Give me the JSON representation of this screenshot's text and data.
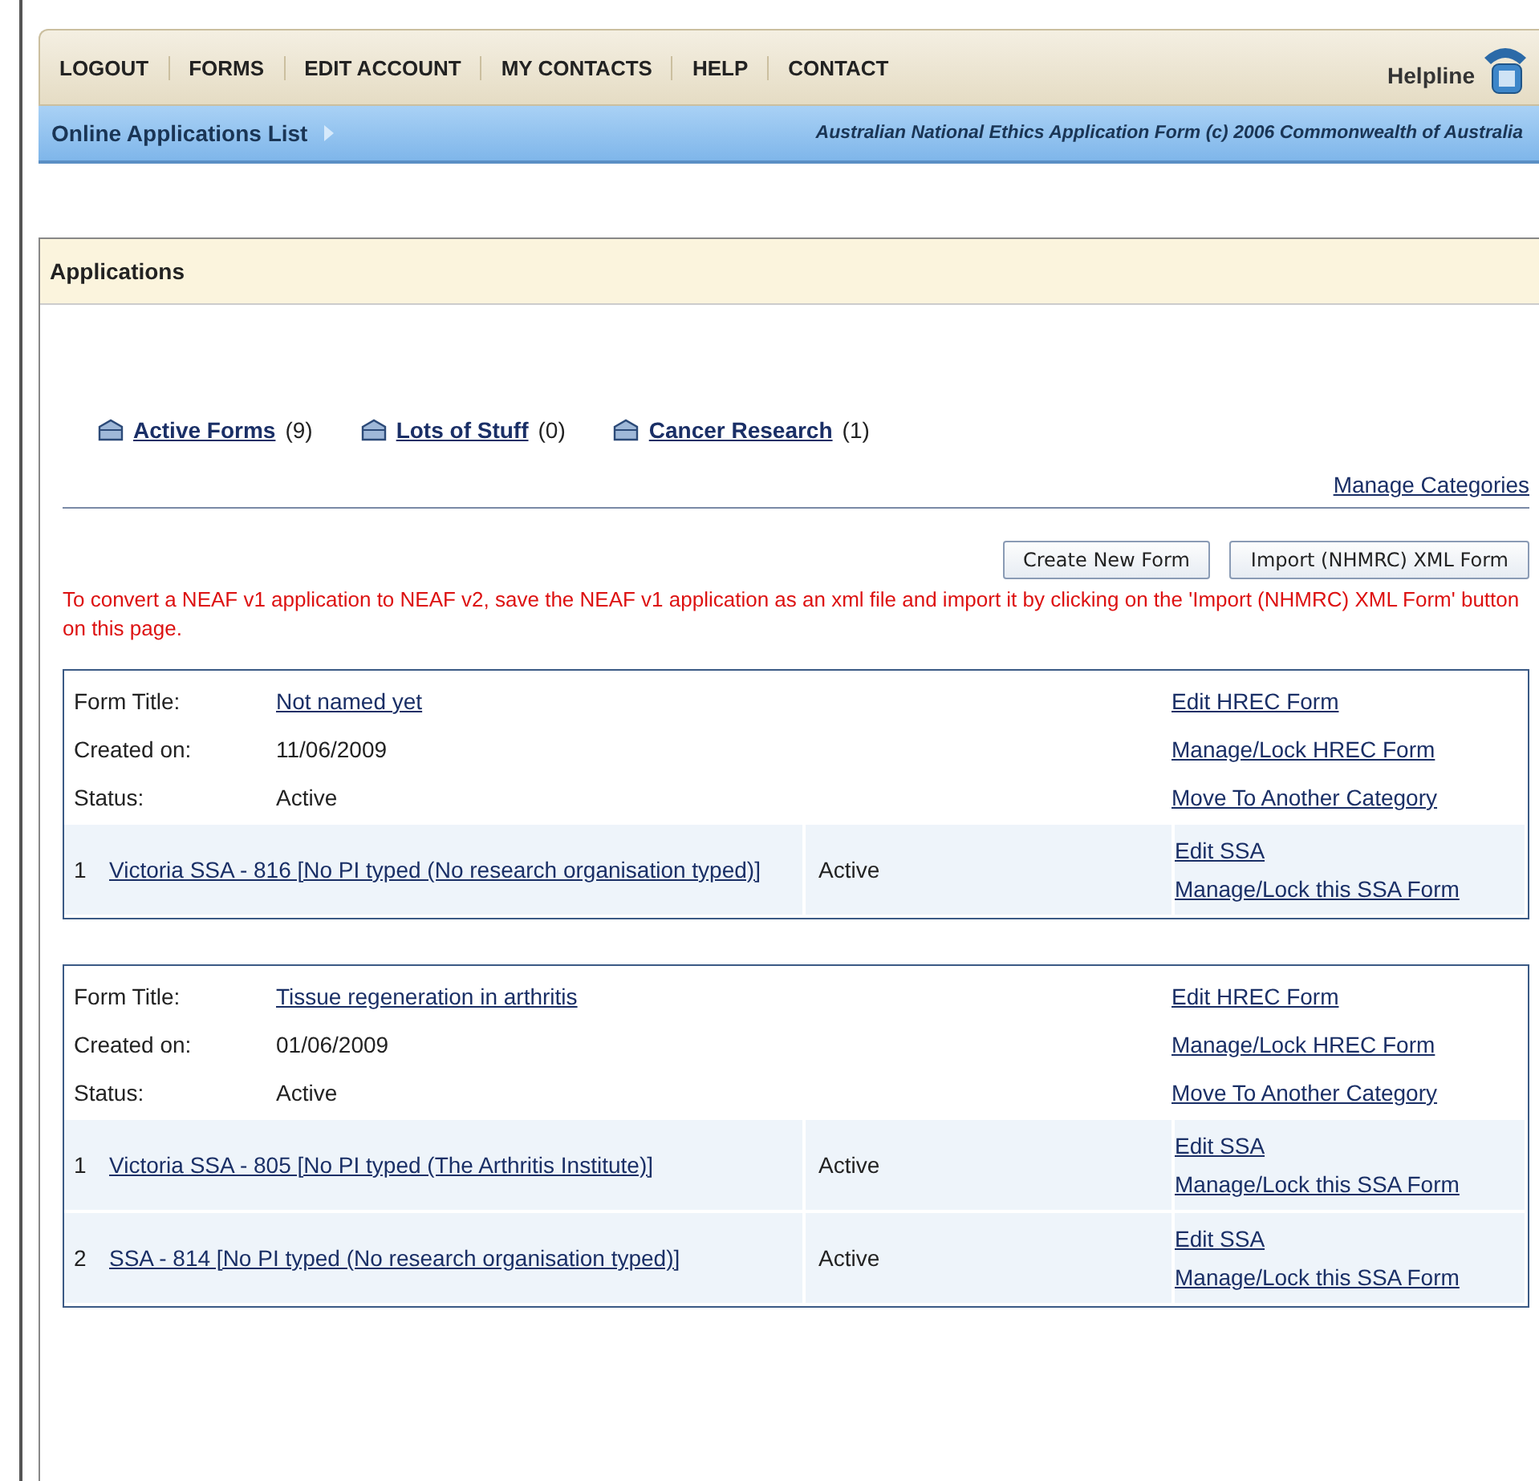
{
  "nav": {
    "items": [
      {
        "label": "LOGOUT"
      },
      {
        "label": "FORMS"
      },
      {
        "label": "EDIT ACCOUNT"
      },
      {
        "label": "MY CONTACTS"
      },
      {
        "label": "HELP"
      },
      {
        "label": "CONTACT"
      }
    ],
    "helpline": "Helpline"
  },
  "subheader": {
    "title": "Online Applications List",
    "credit": "Australian National Ethics Application Form (c) 2006 Commonwealth of Australia"
  },
  "panel": {
    "title": "Applications",
    "categories": [
      {
        "name": "Active Forms",
        "count": "(9)"
      },
      {
        "name": "Lots of Stuff",
        "count": "(0)"
      },
      {
        "name": "Cancer Research",
        "count": "(1)"
      }
    ],
    "manage_link": "Manage Categories",
    "buttons": [
      "Create New Form",
      "Import (NHMRC) XML Form"
    ],
    "notice": "To convert a NEAF v1 application to NEAF v2, save the NEAF v1 application as an xml file and import it by clicking on the 'Import (NHMRC) XML Form' button on this page.",
    "forms": [
      {
        "title_label": "Form Title:",
        "title": "Not named yet",
        "created_label": "Created on:",
        "created": "11/06/2009",
        "status_label": "Status:",
        "status": "Active",
        "actions": [
          "Edit HREC Form",
          "Manage/Lock HREC Form",
          "Move To Another Category"
        ],
        "ssas": [
          {
            "number": "1",
            "name": "Victoria SSA - 816 [No PI typed (No research organisation typed)]",
            "status": "Active",
            "actions": [
              "Edit SSA",
              "Manage/Lock this SSA Form"
            ]
          }
        ]
      },
      {
        "title_label": "Form Title:",
        "title": "Tissue regeneration in arthritis",
        "created_label": "Created on:",
        "created": "01/06/2009",
        "status_label": "Status:",
        "status": "Active",
        "actions": [
          "Edit HREC Form",
          "Manage/Lock HREC Form",
          "Move To Another Category"
        ],
        "ssas": [
          {
            "number": "1",
            "name": "Victoria SSA - 805 [No PI typed (The Arthritis Institute)]",
            "status": "Active",
            "actions": [
              "Edit SSA",
              "Manage/Lock this SSA Form"
            ]
          },
          {
            "number": "2",
            "name": "SSA - 814 [No PI typed (No research organisation typed)]",
            "status": "Active",
            "actions": [
              "Edit SSA",
              "Manage/Lock this SSA Form"
            ]
          }
        ]
      }
    ]
  }
}
